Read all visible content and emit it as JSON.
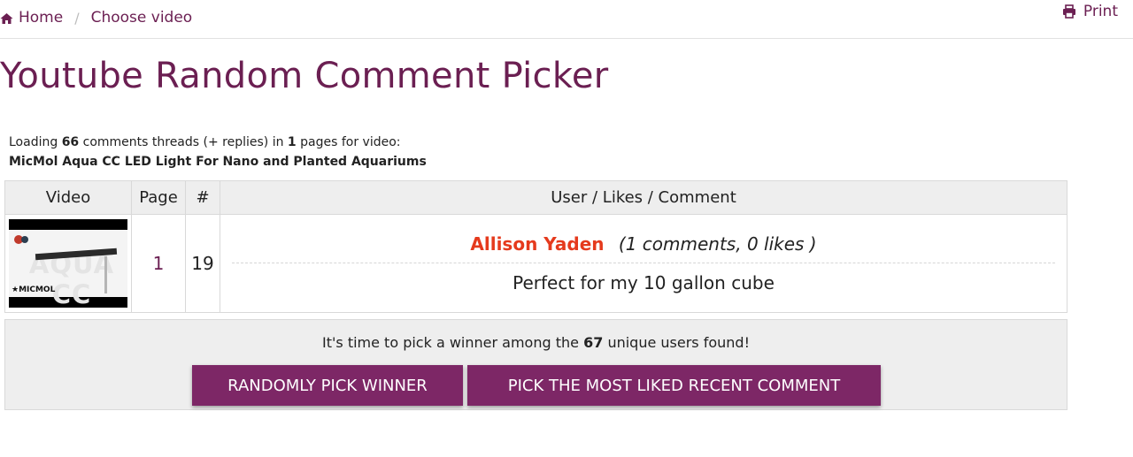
{
  "breadcrumb": {
    "home_label": "Home",
    "current_label": "Choose video",
    "separator": "/"
  },
  "print_label": "Print",
  "page_title": "Youtube Random Comment Picker",
  "loading": {
    "prefix": "Loading",
    "comments_count": "66",
    "mid": "comments threads (+ replies) in",
    "pages_count": "1",
    "suffix": "pages for video:",
    "video_title": "MicMol Aqua CC LED Light For Nano and Planted Aquariums"
  },
  "table": {
    "headers": {
      "video": "Video",
      "page": "Page",
      "index": "#",
      "user": "User / Likes / Comment"
    },
    "row": {
      "thumb_text": "AQUA CC",
      "thumb_brand": "★MICMOL",
      "page": "1",
      "index": "19",
      "user_name": "Allison Yaden",
      "user_meta": "(1 comments, 0 likes )",
      "comment": "Perfect for my 10 gallon cube"
    }
  },
  "pick": {
    "msg_prefix": "It's time to pick a winner among the",
    "unique_users": "67",
    "msg_suffix": "unique users found!",
    "random_button": "RANDOMLY PICK WINNER",
    "liked_button": "PICK THE MOST LIKED RECENT COMMENT"
  },
  "colors": {
    "brand": "#6b1f52",
    "button": "#7d2766",
    "winner": "#e53a1d"
  },
  "icons": {
    "home": "home-icon",
    "print": "print-icon"
  }
}
